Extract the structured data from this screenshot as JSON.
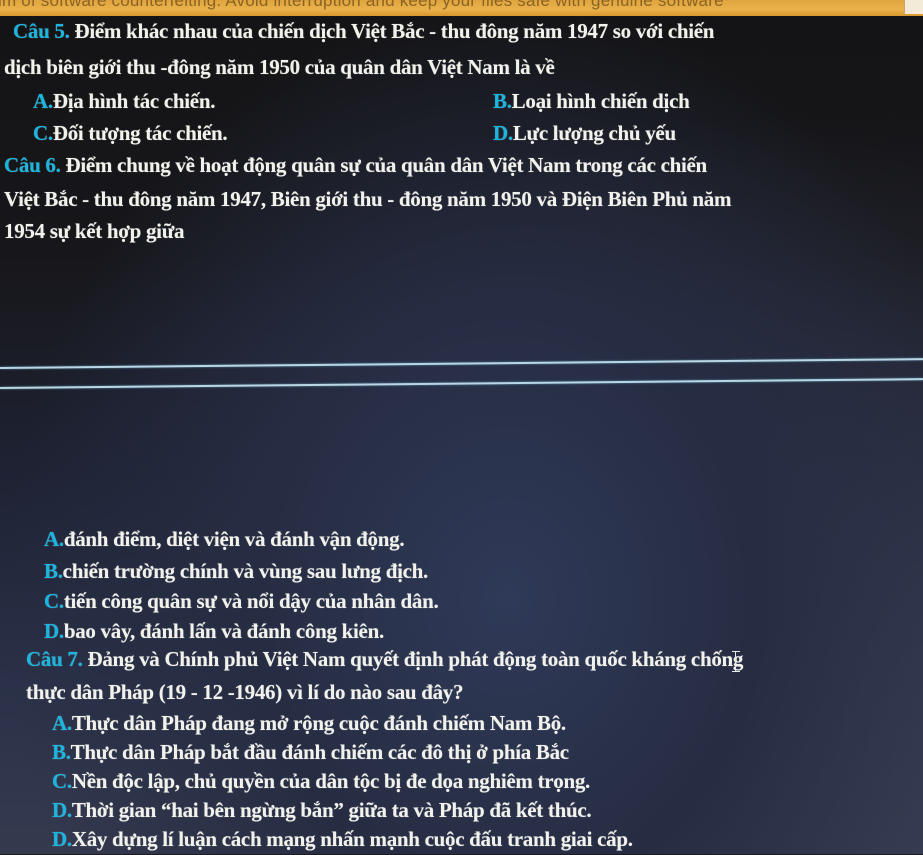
{
  "notification_bar": {
    "text": "im of software counterfeiting. Avoid interruption and keep your files safe with genuine software",
    "color": "#e6a845"
  },
  "slide": {
    "label_color": "#19b6e0",
    "text_color": "#f2f2ec",
    "questions": [
      {
        "label": "Câu 5.",
        "lines": [
          " Điểm khác nhau của chiến dịch Việt Bắc - thu đông năm 1947 so với chiến",
          "dịch biên giới thu -đông năm 1950 của quân dân Việt Nam là về"
        ],
        "options": [
          {
            "label": "A.",
            "text": "Địa hình tác chiến."
          },
          {
            "label": "B.",
            "text": "Loại hình chiến dịch"
          },
          {
            "label": "C.",
            "text": "Đối tượng tác chiến."
          },
          {
            "label": "D.",
            "text": "Lực lượng chủ yếu"
          }
        ]
      },
      {
        "label": "Câu 6.",
        "lines": [
          " Điểm chung về hoạt động quân sự của quân dân Việt Nam trong các chiến",
          "Việt Bắc - thu đông năm 1947, Biên giới thu - đông năm 1950 và Điện Biên Phủ năm",
          "1954 sự kết hợp giữa"
        ],
        "options": [
          {
            "label": "A.",
            "text": "đánh điểm, diệt viện và đánh vận động."
          },
          {
            "label": "B.",
            "text": "chiến trường chính và vùng sau lưng địch."
          },
          {
            "label": "C.",
            "text": "tiến công quân sự và nổi dậy của nhân dân."
          },
          {
            "label": "D.",
            "text": "bao vây, đánh lấn và đánh công kiên."
          }
        ]
      },
      {
        "label": "Câu 7.",
        "lines": [
          " Đảng và Chính phủ Việt Nam quyết định phát động toàn quốc kháng chống",
          "thực dân Pháp (19 - 12 -1946) vì lí do nào sau đây?"
        ],
        "options": [
          {
            "label": "A.",
            "text": "Thực dân Pháp đang mở rộng cuộc đánh chiếm Nam Bộ."
          },
          {
            "label": "B.",
            "text": "Thực dân Pháp bắt đầu đánh chiếm các đô thị ở phía Bắc"
          },
          {
            "label": "C.",
            "text": "Nền độc lập, chủ quyền của dân tộc bị đe dọa nghiêm trọng."
          },
          {
            "label": "D.",
            "text": "Thời gian “hai bên ngừng bắn” giữa ta và Pháp đã kết thúc."
          },
          {
            "label": "D.",
            "text": "Xây dựng lí luận cách mạng nhấn mạnh cuộc đấu tranh giai cấp."
          }
        ]
      }
    ]
  }
}
